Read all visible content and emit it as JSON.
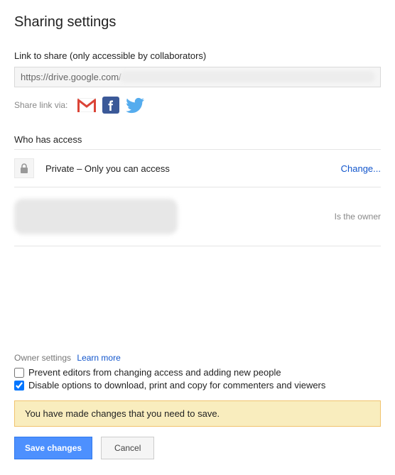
{
  "title": "Sharing settings",
  "link_section": {
    "label": "Link to share (only accessible by collaborators)",
    "value": "https://drive.google.com/"
  },
  "share_via": {
    "label": "Share link via:",
    "icons": {
      "gmail": "gmail-icon",
      "facebook": "facebook-icon",
      "twitter": "twitter-icon"
    }
  },
  "access_section": {
    "label": "Who has access",
    "private_text": "Private – Only you can access",
    "change": "Change...",
    "owner_status": "Is the owner"
  },
  "owner_settings": {
    "label": "Owner settings",
    "learn_more": "Learn more",
    "prevent_editors": {
      "label": "Prevent editors from changing access and adding new people",
      "checked": false
    },
    "disable_download": {
      "label": "Disable options to download, print and copy for commenters and viewers",
      "checked": true
    }
  },
  "notice": "You have made changes that you need to save.",
  "buttons": {
    "save": "Save changes",
    "cancel": "Cancel"
  }
}
